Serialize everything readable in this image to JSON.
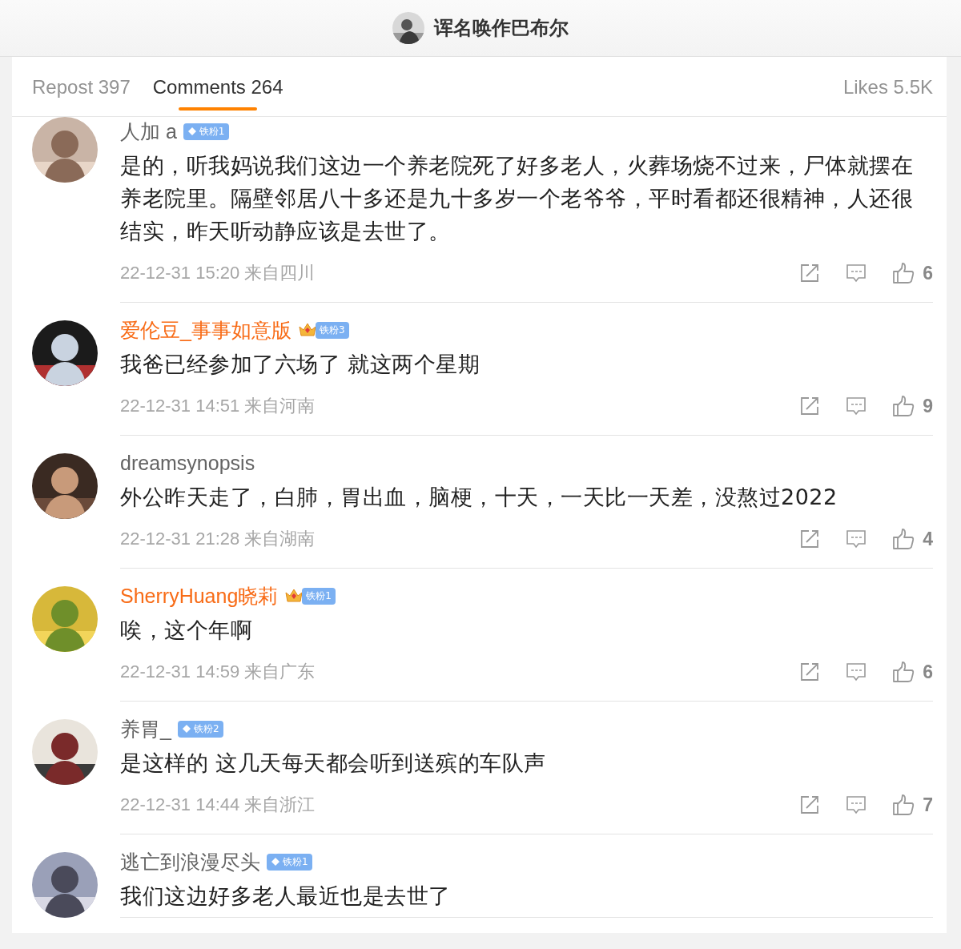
{
  "header": {
    "title": "诨名唤作巴布尔"
  },
  "tabs": [
    {
      "label": "Repost 397",
      "selected": false
    },
    {
      "label": "Comments 264",
      "selected": true
    }
  ],
  "likes_summary": "Likes 5.5K",
  "comments": [
    {
      "name": "人加 a",
      "vip": false,
      "badge": {
        "kind": "diamond",
        "label": "铁粉1"
      },
      "text": "是的，听我妈说我们这边一个养老院死了好多老人，火葬场烧不过来，尸体就摆在养老院里。隔壁邻居八十多还是九十多岁一个老爷爷，平时看都还很精神，人还很结实，昨天听动静应该是去世了。",
      "time": "22-12-31 15:20 来自四川",
      "likes": "6"
    },
    {
      "name": "爱伦豆_事事如意版",
      "vip": true,
      "badge": {
        "kind": "crown",
        "label": "铁粉3"
      },
      "text": "我爸已经参加了六场了 就这两个星期",
      "time": "22-12-31 14:51 来自河南",
      "likes": "9"
    },
    {
      "name": "dreamsynopsis",
      "vip": false,
      "text": "外公昨天走了，白肺，胃出血，脑梗，十天，一天比一天差，没熬过2022",
      "time": "22-12-31 21:28 来自湖南",
      "likes": "4"
    },
    {
      "name": "SherryHuang晓莉",
      "vip": true,
      "badge": {
        "kind": "crown",
        "label": "铁粉1"
      },
      "text": "唉，这个年啊",
      "time": "22-12-31 14:59 来自广东",
      "likes": "6"
    },
    {
      "name": "养胃_",
      "vip": false,
      "badge": {
        "kind": "diamond",
        "label": "铁粉2"
      },
      "text": "是这样的 这几天每天都会听到送殡的车队声",
      "time": "22-12-31 14:44 来自浙江",
      "likes": "7"
    },
    {
      "name": "逃亡到浪漫尽头",
      "vip": false,
      "badge": {
        "kind": "diamond",
        "label": "铁粉1"
      },
      "text": "我们这边好多老人最近也是去世了"
    }
  ]
}
